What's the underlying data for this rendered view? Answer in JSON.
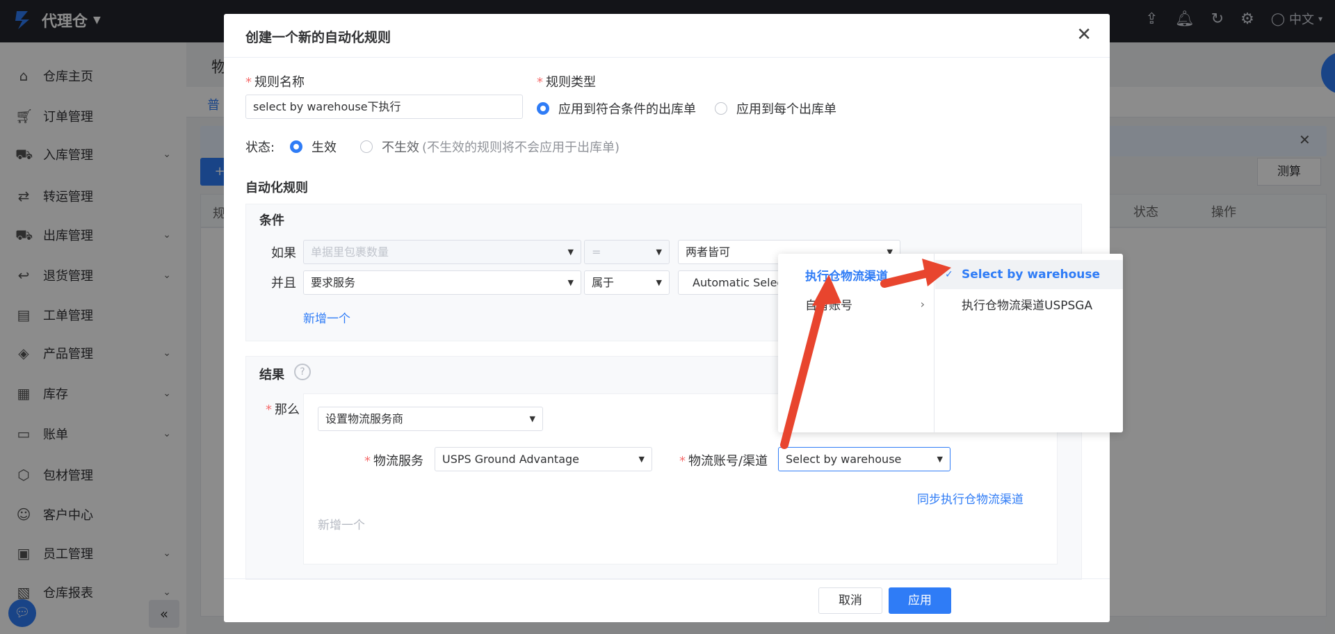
{
  "app": {
    "title": "代理仓",
    "lang": "中文"
  },
  "sidebar": {
    "items": [
      {
        "label": "仓库主页",
        "icon": "home-icon",
        "arrow": false
      },
      {
        "label": "订单管理",
        "icon": "cart-icon",
        "arrow": false
      },
      {
        "label": "入库管理",
        "icon": "truck-in-icon",
        "arrow": true
      },
      {
        "label": "转运管理",
        "icon": "transfer-icon",
        "arrow": false
      },
      {
        "label": "出库管理",
        "icon": "truck-out-icon",
        "arrow": true
      },
      {
        "label": "退货管理",
        "icon": "return-icon",
        "arrow": true
      },
      {
        "label": "工单管理",
        "icon": "ticket-icon",
        "arrow": false
      },
      {
        "label": "产品管理",
        "icon": "tag-icon",
        "arrow": true
      },
      {
        "label": "库存",
        "icon": "stock-icon",
        "arrow": true
      },
      {
        "label": "账单",
        "icon": "bill-icon",
        "arrow": true
      },
      {
        "label": "包材管理",
        "icon": "package-icon",
        "arrow": false
      },
      {
        "label": "客户中心",
        "icon": "customer-icon",
        "arrow": false
      },
      {
        "label": "员工管理",
        "icon": "staff-icon",
        "arrow": true
      },
      {
        "label": "仓库报表",
        "icon": "report-icon",
        "arrow": true
      }
    ]
  },
  "background": {
    "page_title_frag": "物",
    "tab_frag": "普",
    "btn_frag": "+",
    "col_frag": "规",
    "measure": "测算",
    "col_status": "状态",
    "col_action": "操作"
  },
  "dialog": {
    "title": "创建一个新的自动化规则",
    "rule_name_label": "规则名称",
    "rule_name_value": "select by warehouse下执行",
    "rule_type_label": "规则类型",
    "rule_type_opt1": "应用到符合条件的出库单",
    "rule_type_opt2": "应用到每个出库单",
    "status_label": "状态:",
    "status_on": "生效",
    "status_off": "不生效",
    "status_off_note": "(不生效的规则将不会应用于出库单)",
    "automation_title": "自动化规则",
    "conditions_title": "条件",
    "if_label": "如果",
    "if_field": "单据里包裹数量",
    "if_op": "=",
    "if_value": "两者皆可",
    "and_label": "并且",
    "and_field": "要求服务",
    "and_op": "属于",
    "and_value": "Automatic Selec",
    "add_condition": "新增一个",
    "results_title": "结果",
    "then_label": "那么",
    "action_select": "设置物流服务商",
    "logistics_service_label": "物流服务",
    "logistics_service_value": "USPS Ground Advantage",
    "account_channel_label": "物流账号/渠道",
    "account_channel_value": "Select by warehouse",
    "sync_link": "同步执行仓物流渠道",
    "add_result": "新增一个",
    "cancel": "取消",
    "apply": "应用"
  },
  "cascader": {
    "col1": [
      {
        "label": "执行仓物流渠道",
        "active": true
      },
      {
        "label": "自有账号",
        "active": false
      }
    ],
    "col2": [
      {
        "label": "Select by warehouse",
        "selected": true
      },
      {
        "label": "执行仓物流渠道USPSGA",
        "selected": false
      }
    ]
  },
  "colors": {
    "primary": "#2f7cf6",
    "danger": "#f56c6c",
    "arrow": "#e8452e"
  }
}
